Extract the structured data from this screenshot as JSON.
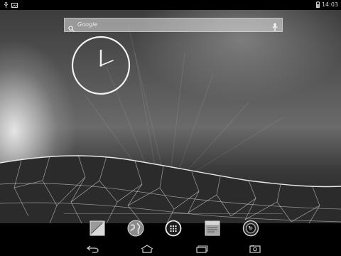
{
  "status_bar": {
    "time": "14:03",
    "left_icons": [
      "usb-icon",
      "image-notification-icon"
    ],
    "right_icons": [
      "battery-icon"
    ]
  },
  "search": {
    "placeholder": "Google",
    "voice_icon": "mic-icon"
  },
  "clock": {
    "style": "analog"
  },
  "dock": {
    "apps": [
      {
        "name": "gallery",
        "icon": "gallery-icon"
      },
      {
        "name": "browser",
        "icon": "globe-icon"
      },
      {
        "name": "all-apps",
        "icon": "app-drawer-icon"
      },
      {
        "name": "notes",
        "icon": "notes-icon"
      },
      {
        "name": "camera",
        "icon": "camera-icon"
      }
    ]
  },
  "nav_bar": {
    "buttons": [
      "back-icon",
      "home-icon",
      "recents-icon",
      "screenshot-icon"
    ]
  },
  "colors": {
    "status_bar_bg": "#000000",
    "nav_bar_bg": "#000000",
    "search_bar_bg": "#bdbdbd"
  }
}
